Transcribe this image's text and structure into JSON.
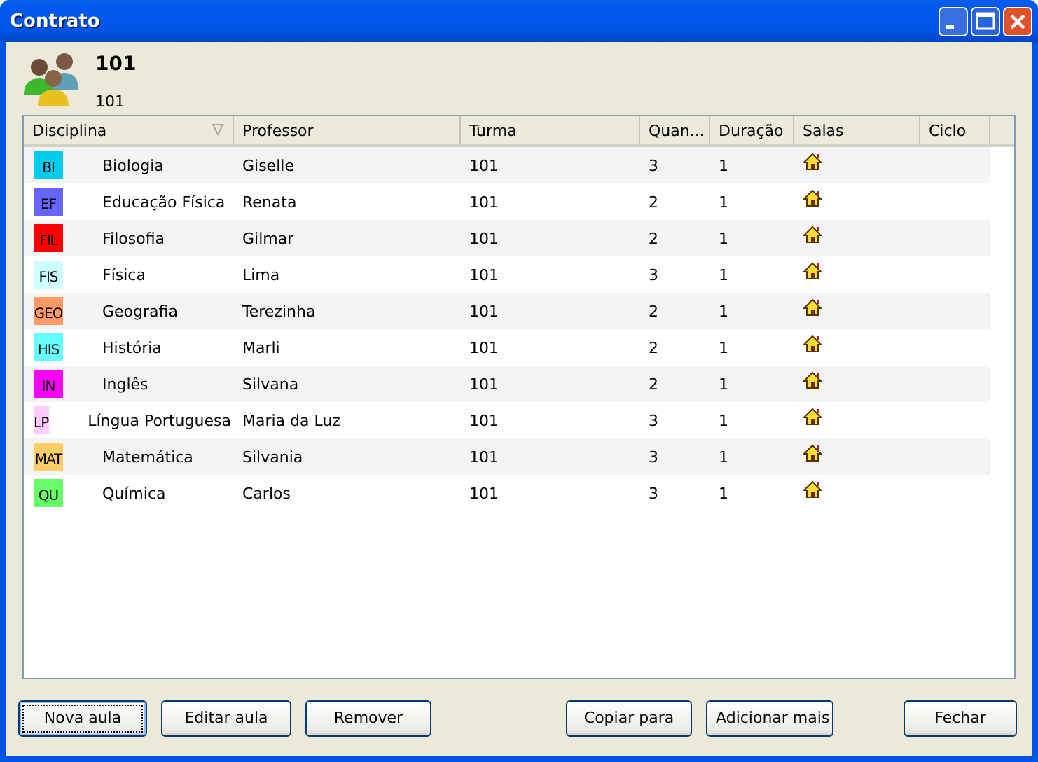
{
  "window": {
    "title": "Contrato"
  },
  "header": {
    "title": "101",
    "subtitle": "101"
  },
  "table": {
    "columns": [
      {
        "label": "Disciplina",
        "sorted": true
      },
      {
        "label": "Professor",
        "sorted": false
      },
      {
        "label": "Turma",
        "sorted": false
      },
      {
        "label": "Quan...",
        "sorted": false
      },
      {
        "label": "Duração",
        "sorted": false
      },
      {
        "label": "Salas",
        "sorted": false
      },
      {
        "label": "Ciclo",
        "sorted": false
      }
    ],
    "rows": [
      {
        "badge": "BI",
        "color": "#00ccee",
        "disciplina": "Biologia",
        "professor": "Giselle",
        "turma": "101",
        "quantidade": "3",
        "duracao": "1"
      },
      {
        "badge": "EF",
        "color": "#6666ff",
        "disciplina": "Educação Física",
        "professor": "Renata",
        "turma": "101",
        "quantidade": "2",
        "duracao": "1"
      },
      {
        "badge": "FIL",
        "color": "#ff0000",
        "disciplina": "Filosofia",
        "professor": "Gilmar",
        "turma": "101",
        "quantidade": "2",
        "duracao": "1"
      },
      {
        "badge": "FIS",
        "color": "#ccffff",
        "disciplina": "Física",
        "professor": "Lima",
        "turma": "101",
        "quantidade": "3",
        "duracao": "1"
      },
      {
        "badge": "GEO",
        "color": "#ff9966",
        "disciplina": "Geografia",
        "professor": "Terezinha",
        "turma": "101",
        "quantidade": "2",
        "duracao": "1"
      },
      {
        "badge": "HIS",
        "color": "#66ffff",
        "disciplina": "História",
        "professor": "Marli",
        "turma": "101",
        "quantidade": "2",
        "duracao": "1"
      },
      {
        "badge": "IN",
        "color": "#ff00ff",
        "disciplina": "Inglês",
        "professor": "Silvana",
        "turma": "101",
        "quantidade": "2",
        "duracao": "1"
      },
      {
        "badge": "LP",
        "color": "#ffccff",
        "disciplina": "Língua Portuguesa",
        "professor": "Maria da Luz",
        "turma": "101",
        "quantidade": "3",
        "duracao": "1"
      },
      {
        "badge": "MAT",
        "color": "#ffcc66",
        "disciplina": "Matemática",
        "professor": "Silvania",
        "turma": "101",
        "quantidade": "3",
        "duracao": "1"
      },
      {
        "badge": "QU",
        "color": "#66ff66",
        "disciplina": "Química",
        "professor": "Carlos",
        "turma": "101",
        "quantidade": "3",
        "duracao": "1"
      }
    ]
  },
  "button_groups": [
    [
      {
        "label": "Nova aula",
        "default": true
      },
      {
        "label": "Editar aula",
        "default": false
      },
      {
        "label": "Remover",
        "default": false
      }
    ],
    [
      {
        "label": "Copiar para",
        "default": false
      },
      {
        "label": "Adicionar mais",
        "default": false
      }
    ],
    [
      {
        "label": "Fechar",
        "default": false
      }
    ]
  ]
}
